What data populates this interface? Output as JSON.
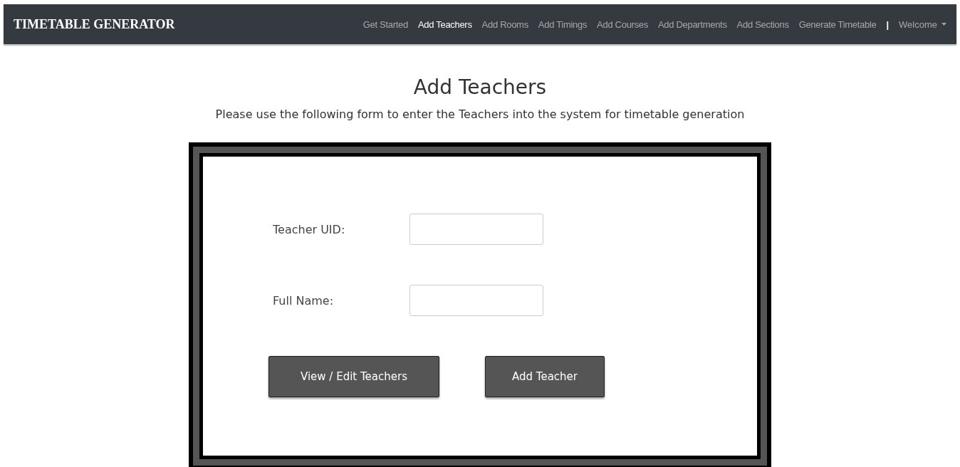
{
  "navbar": {
    "brand": "TIMETABLE GENERATOR",
    "links": [
      {
        "label": "Get Started",
        "selected": false
      },
      {
        "label": "Add Teachers",
        "selected": true
      },
      {
        "label": "Add Rooms",
        "selected": false
      },
      {
        "label": "Add Timings",
        "selected": false
      },
      {
        "label": "Add Courses",
        "selected": false
      },
      {
        "label": "Add Departments",
        "selected": false
      },
      {
        "label": "Add Sections",
        "selected": false
      },
      {
        "label": "Generate Timetable",
        "selected": false
      }
    ],
    "separator": "|",
    "user_menu": {
      "label": "Welcome",
      "expanded": false
    }
  },
  "heading": "Add Teachers",
  "subtitle": "Please use the following form to enter the Teachers into the system for timetable generation",
  "form": {
    "fields": [
      {
        "label": "Teacher UID:"
      },
      {
        "label": "Full Name:"
      }
    ],
    "buttons": [
      "View / Edit Teachers",
      "Add Teacher"
    ]
  }
}
